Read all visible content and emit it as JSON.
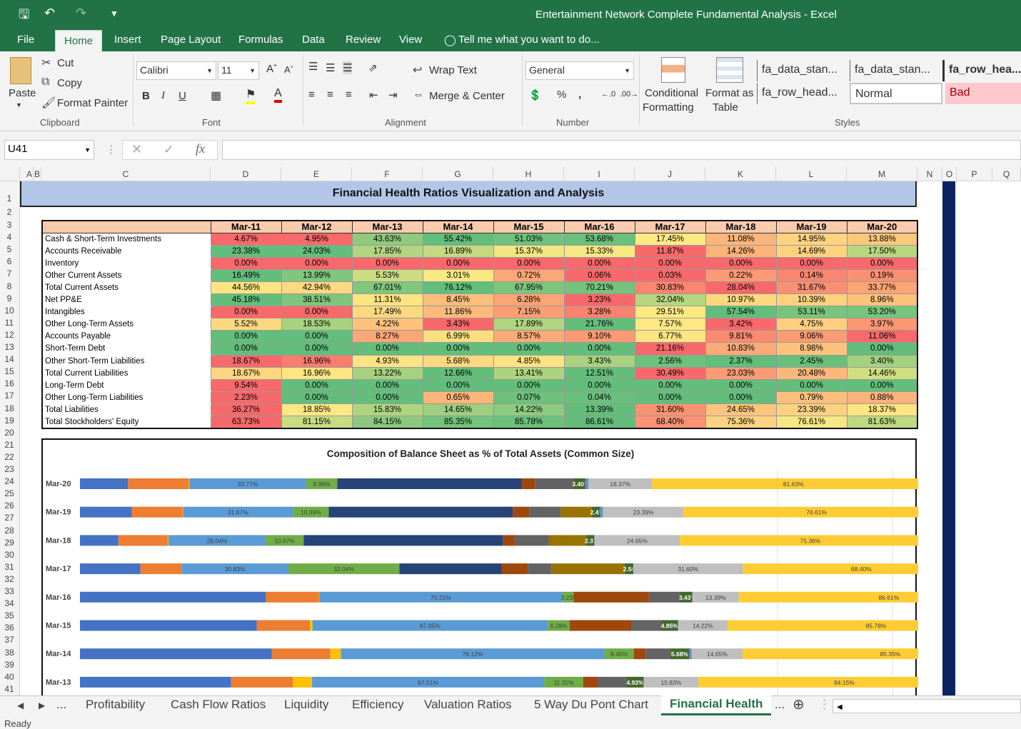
{
  "window": {
    "title": "Entertainment Network Complete Fundamental Analysis - Excel"
  },
  "ribbon_tabs": [
    "File",
    "Home",
    "Insert",
    "Page Layout",
    "Formulas",
    "Data",
    "Review",
    "View"
  ],
  "tell_me": "Tell me what you want to do...",
  "clipboard": {
    "paste": "Paste",
    "cut": "Cut",
    "copy": "Copy",
    "format_painter": "Format Painter",
    "label": "Clipboard"
  },
  "font": {
    "name": "Calibri",
    "size": "11",
    "label": "Font"
  },
  "alignment": {
    "wrap": "Wrap Text",
    "merge": "Merge & Center",
    "label": "Alignment"
  },
  "number": {
    "format": "General",
    "percent": "%",
    "comma": ",",
    "label": "Number"
  },
  "styles": {
    "conditional": "Conditional",
    "formatting": "Formatting",
    "format_as": "Format as",
    "table": "Table",
    "label": "Styles",
    "cells": [
      "fa_data_stan...",
      "fa_data_stan...",
      "fa_row_hea...",
      "fa_row_head...",
      "Normal",
      "Bad"
    ]
  },
  "name_box": "U41",
  "columns": [
    "A",
    "B",
    "C",
    "D",
    "E",
    "F",
    "G",
    "H",
    "I",
    "J",
    "K",
    "L",
    "M",
    "N",
    "O",
    "P",
    "Q"
  ],
  "rows": [
    "1",
    "2",
    "3",
    "4",
    "5",
    "6",
    "7",
    "8",
    "9",
    "10",
    "11",
    "12",
    "13",
    "14",
    "15",
    "16",
    "17",
    "18",
    "19",
    "20",
    "21",
    "22",
    "23",
    "24",
    "25",
    "26",
    "27",
    "28",
    "29",
    "30",
    "31",
    "32",
    "33",
    "34",
    "35",
    "36",
    "37",
    "38",
    "39",
    "40",
    "41"
  ],
  "banner": "Financial Health Ratios Visualization and Analysis",
  "table": {
    "years": [
      "Mar-11",
      "Mar-12",
      "Mar-13",
      "Mar-14",
      "Mar-15",
      "Mar-16",
      "Mar-17",
      "Mar-18",
      "Mar-19",
      "Mar-20"
    ],
    "rows": [
      {
        "label": "Cash & Short-Term Investments",
        "values": [
          "4.67%",
          "4.95%",
          "43.63%",
          "55.42%",
          "51.03%",
          "53.68%",
          "17.45%",
          "11.08%",
          "14.95%",
          "13.88%"
        ],
        "colors": [
          "#f8696b",
          "#f8696b",
          "#8fca7e",
          "#63be7b",
          "#70c27c",
          "#6ac07b",
          "#feeb84",
          "#fcb57a",
          "#fdd480",
          "#fcc87d"
        ]
      },
      {
        "label": "Accounts Receivable",
        "values": [
          "23.38%",
          "24.03%",
          "17.85%",
          "16.89%",
          "15.37%",
          "15.33%",
          "11.87%",
          "14.26%",
          "14.69%",
          "17.50%"
        ],
        "colors": [
          "#63be7b",
          "#63be7b",
          "#b1d580",
          "#c4da81",
          "#f1e783",
          "#f6e883",
          "#f8696b",
          "#fcb47a",
          "#fdd27f",
          "#b9d780"
        ]
      },
      {
        "label": "Inventory",
        "values": [
          "0.00%",
          "0.00%",
          "0.00%",
          "0.00%",
          "0.00%",
          "0.00%",
          "0.00%",
          "0.00%",
          "0.00%",
          "0.00%"
        ],
        "colors": [
          "#f8696b",
          "#f8696b",
          "#f8696b",
          "#f8696b",
          "#f8696b",
          "#f8696b",
          "#f8696b",
          "#f8696b",
          "#f8696b",
          "#f8696b"
        ]
      },
      {
        "label": "Other Current Assets",
        "values": [
          "16.49%",
          "13.99%",
          "5.53%",
          "3.01%",
          "0.72%",
          "0.06%",
          "0.03%",
          "0.22%",
          "0.14%",
          "0.19%"
        ],
        "colors": [
          "#63be7b",
          "#80c67d",
          "#cbdc81",
          "#f9e983",
          "#fba776",
          "#f8696b",
          "#f8696b",
          "#fb9a74",
          "#f98670",
          "#fa9072"
        ]
      },
      {
        "label": "Total Current Assets",
        "values": [
          "44.56%",
          "42.94%",
          "67.01%",
          "76.12%",
          "67.95%",
          "70.21%",
          "30.83%",
          "28.04%",
          "31.67%",
          "33.77%"
        ],
        "colors": [
          "#fee482",
          "#fed981",
          "#80c67d",
          "#63be7b",
          "#7dc57d",
          "#75c37c",
          "#f98770",
          "#f8696b",
          "#fa9072",
          "#fba576"
        ]
      },
      {
        "label": "Net PP&E",
        "values": [
          "45.18%",
          "38.51%",
          "11.31%",
          "8.45%",
          "6.28%",
          "3.23%",
          "32.04%",
          "10.97%",
          "10.39%",
          "8.96%"
        ],
        "colors": [
          "#63be7b",
          "#7fc67d",
          "#fee482",
          "#fdbd7b",
          "#fba476",
          "#f8696b",
          "#b7d680",
          "#fed980",
          "#fdd17f",
          "#fdc27c"
        ]
      },
      {
        "label": "Intangibles",
        "values": [
          "0.00%",
          "0.00%",
          "17.49%",
          "11.86%",
          "7.15%",
          "3.28%",
          "29.51%",
          "57.54%",
          "53.11%",
          "53.20%"
        ],
        "colors": [
          "#f8696b",
          "#f8696b",
          "#fed880",
          "#fdbb7b",
          "#fba075",
          "#f98270",
          "#feea83",
          "#63be7b",
          "#78c47c",
          "#77c47c"
        ]
      },
      {
        "label": "Other Long-Term Assets",
        "values": [
          "5.52%",
          "18.53%",
          "4.22%",
          "3.43%",
          "17.89%",
          "21.76%",
          "7.57%",
          "3.42%",
          "4.75%",
          "3.97%"
        ],
        "colors": [
          "#fed880",
          "#a8d27f",
          "#fdc27c",
          "#f8696b",
          "#b0d480",
          "#63be7b",
          "#fee883",
          "#f8696b",
          "#fecf80",
          "#fb9773"
        ]
      },
      {
        "label": "Accounts Payable",
        "values": [
          "0.00%",
          "0.00%",
          "8.27%",
          "6.99%",
          "8.57%",
          "9.10%",
          "6.77%",
          "9.81%",
          "9.06%",
          "11.06%"
        ],
        "colors": [
          "#63be7b",
          "#63be7b",
          "#fca776",
          "#fede81",
          "#fbab77",
          "#fa9b74",
          "#fee583",
          "#f98b71",
          "#fa9c74",
          "#f8696b"
        ]
      },
      {
        "label": "Short-Term Debt",
        "values": [
          "0.00%",
          "0.00%",
          "0.00%",
          "0.00%",
          "0.00%",
          "0.00%",
          "21.16%",
          "10.83%",
          "8.98%",
          "0.00%"
        ],
        "colors": [
          "#63be7b",
          "#63be7b",
          "#63be7b",
          "#63be7b",
          "#63be7b",
          "#63be7b",
          "#f8696b",
          "#fcaa77",
          "#fdc37d",
          "#63be7b"
        ]
      },
      {
        "label": "Other Short-Term Liabilities",
        "values": [
          "18.67%",
          "16.96%",
          "4.93%",
          "5.68%",
          "4.85%",
          "3.43%",
          "2.56%",
          "2.37%",
          "2.45%",
          "3.40%"
        ],
        "colors": [
          "#f8696b",
          "#f97d6f",
          "#fee482",
          "#fed981",
          "#fee483",
          "#a8d27f",
          "#6ec27c",
          "#63be7b",
          "#69c07b",
          "#a5d17f"
        ]
      },
      {
        "label": "Total Current Liabilities",
        "values": [
          "18.67%",
          "16.96%",
          "13.22%",
          "12.66%",
          "13.41%",
          "12.51%",
          "30.49%",
          "23.03%",
          "20.48%",
          "14.46%"
        ],
        "colors": [
          "#fed580",
          "#fee582",
          "#a5d17f",
          "#63be7b",
          "#acd37f",
          "#63be7b",
          "#f8696b",
          "#fb9b74",
          "#fcb77a",
          "#d0de82"
        ]
      },
      {
        "label": "Long-Term Debt",
        "values": [
          "9.54%",
          "0.00%",
          "0.00%",
          "0.00%",
          "0.00%",
          "0.00%",
          "0.00%",
          "0.00%",
          "0.00%",
          "0.00%"
        ],
        "colors": [
          "#f8696b",
          "#63be7b",
          "#63be7b",
          "#63be7b",
          "#63be7b",
          "#63be7b",
          "#63be7b",
          "#63be7b",
          "#63be7b",
          "#63be7b"
        ]
      },
      {
        "label": "Other Long-Term Liabilities",
        "values": [
          "2.23%",
          "0.00%",
          "0.00%",
          "0.65%",
          "0.07%",
          "0.04%",
          "0.00%",
          "0.00%",
          "0.79%",
          "0.88%"
        ],
        "colors": [
          "#f8696b",
          "#63be7b",
          "#63be7b",
          "#fcb67a",
          "#6dc17c",
          "#69c07b",
          "#63be7b",
          "#63be7b",
          "#fdbf7b",
          "#fcb47a"
        ]
      },
      {
        "label": "Total Liabilities",
        "values": [
          "36.27%",
          "18.85%",
          "15.83%",
          "14.65%",
          "14.22%",
          "13.39%",
          "31.60%",
          "24.65%",
          "23.39%",
          "18.37%"
        ],
        "colors": [
          "#f8696b",
          "#fee883",
          "#afd480",
          "#9ccf7f",
          "#8dcb7e",
          "#63be7b",
          "#fa9372",
          "#fdc57d",
          "#fed280",
          "#fee683"
        ]
      },
      {
        "label": "Total Stockholders' Equity",
        "values": [
          "63.73%",
          "81.15%",
          "84.15%",
          "85.35%",
          "85.78%",
          "86.61%",
          "68.40%",
          "75.36%",
          "76.61%",
          "81.63%"
        ],
        "colors": [
          "#f8696b",
          "#c9dc81",
          "#8bca7e",
          "#75c37c",
          "#6cc07b",
          "#63be7b",
          "#fa9273",
          "#fed381",
          "#f7e783",
          "#bfd980"
        ]
      }
    ]
  },
  "chart_data": {
    "type": "bar",
    "orientation": "horizontal-stacked",
    "title": "Composition of Balance Sheet as % of Total Assets (Common Size)",
    "categories": [
      "Mar-20",
      "Mar-19",
      "Mar-18",
      "Mar-17",
      "Mar-16",
      "Mar-15",
      "Mar-14",
      "Mar-13"
    ],
    "segments": [
      {
        "values": [
          13.88,
          14.95,
          11.08,
          17.45,
          53.68,
          51.03,
          55.42,
          43.63
        ],
        "color": "#4472c4"
      },
      {
        "values": [
          17.5,
          14.69,
          14.26,
          11.87,
          15.33,
          15.37,
          16.89,
          17.85
        ],
        "color": "#ed7d31"
      },
      {
        "values": [
          0.19,
          0.14,
          0.22,
          0.03,
          0.06,
          0.72,
          3.01,
          5.53
        ],
        "color": "#ffc000"
      },
      {
        "values": [
          33.77,
          31.67,
          28.04,
          30.83,
          70.21,
          67.95,
          76.12,
          67.01
        ],
        "color": "#5b9bd5",
        "show_label": true
      },
      {
        "values": [
          8.96,
          10.39,
          10.97,
          32.04,
          3.23,
          6.28,
          8.45,
          11.31
        ],
        "color": "#70ad47",
        "show_label": true
      },
      {
        "values": [
          53.2,
          53.11,
          57.54,
          29.51,
          0,
          0,
          0,
          0
        ],
        "color": "#264478"
      },
      {
        "values": [
          3.97,
          4.75,
          3.42,
          7.57,
          21.76,
          17.89,
          3.43,
          4.22
        ],
        "color": "#9e480e"
      },
      {
        "values": [
          11.06,
          9.06,
          9.81,
          6.77,
          9.1,
          8.57,
          6.99,
          8.27
        ],
        "color": "#636363"
      },
      {
        "values": [
          0,
          8.98,
          10.83,
          21.16,
          0,
          0,
          0,
          0
        ],
        "color": "#997300"
      },
      {
        "values": [
          3.4,
          2.45,
          2.37,
          2.56,
          3.43,
          4.85,
          5.68,
          4.93
        ],
        "color": "#43682b",
        "show_label": true
      },
      {
        "values": [
          0.88,
          0.79,
          0,
          0,
          0.04,
          0.07,
          0.65,
          0
        ],
        "color": "#698ed0"
      },
      {
        "values": [
          18.37,
          23.39,
          24.65,
          31.6,
          13.39,
          14.22,
          14.65,
          15.83
        ],
        "color": "#bfbfbf",
        "show_label": true
      },
      {
        "values": [
          81.63,
          76.61,
          75.36,
          68.4,
          86.61,
          85.78,
          85.35,
          84.15
        ],
        "color": "#ffcd33",
        "show_label": true
      }
    ],
    "inline_labels": [
      [
        "33.77%",
        "8.96%",
        "3.40%",
        "0.00%",
        "18.37%",
        "81.63%"
      ],
      [
        "31.67%",
        "10.39%",
        "2.45%",
        "0.00%",
        "23.39%",
        "76.61%"
      ],
      [
        "28.04%",
        "10.97%",
        "2.37%",
        "0.00%",
        "24.65%",
        "75.36%"
      ],
      [
        "30.83%",
        "32.04%",
        "2.56%",
        "0.00%",
        "31.60%",
        "68.40%"
      ],
      [
        "70.21%",
        "3.23%",
        "3.43%",
        "0.00%",
        "13.39%",
        "86.61%"
      ],
      [
        "67.95%",
        "6.28%",
        "4.85%",
        "0.00%",
        "14.22%",
        "85.78%"
      ],
      [
        "76.12%",
        "8.45%",
        "5.68%",
        "0.00%",
        "14.65%",
        "85.35%"
      ],
      [
        "67.01%",
        "11.31%",
        "4.93%",
        "0.00%",
        "15.83%",
        "84.15%"
      ]
    ]
  },
  "sheet_tabs": [
    "Profitability",
    "Cash Flow Ratios",
    "Liquidity",
    "Efficiency",
    "Valuation Ratios",
    "5 Way Du Pont Chart",
    "Financial Health"
  ],
  "status": "Ready"
}
